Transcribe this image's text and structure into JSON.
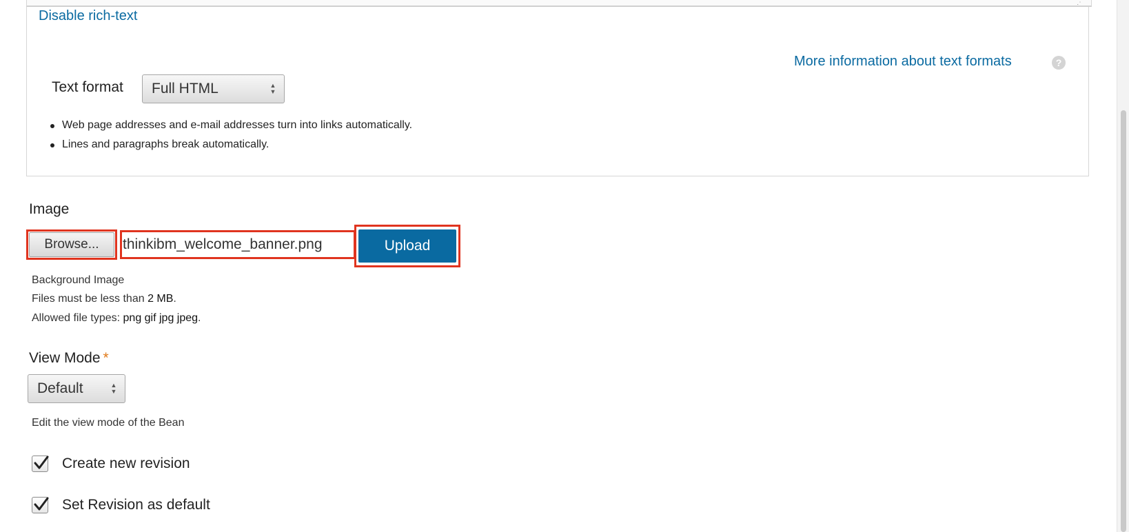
{
  "editor": {
    "disable_rich_text_link": "Disable rich-text",
    "more_info_link": "More information about text formats",
    "help_icon_glyph": "?",
    "text_format_label": "Text format",
    "text_format_value": "Full HTML",
    "filter_tips": [
      "Web page addresses and e-mail addresses turn into links automatically.",
      "Lines and paragraphs break automatically."
    ]
  },
  "image_field": {
    "label": "Image",
    "browse_label": "Browse...",
    "file_name": "thinkibm_welcome_banner.png",
    "upload_label": "Upload",
    "description": "Background Image",
    "size_prefix": "Files must be less than ",
    "size_value": "2 MB",
    "size_suffix": ".",
    "types_prefix": "Allowed file types: ",
    "types_value": "png gif jpg jpeg",
    "types_suffix": "."
  },
  "view_mode": {
    "label": "View Mode",
    "required_marker": "*",
    "value": "Default",
    "description": "Edit the view mode of the Bean"
  },
  "options": {
    "create_revision_label": "Create new revision",
    "create_revision_checked": true,
    "set_default_label": "Set Revision as default",
    "set_default_checked": true
  },
  "colors": {
    "link": "#0a6aa1",
    "upload_button": "#0a6aa1",
    "highlight_border": "#e0341f",
    "required_marker": "#e07a1a"
  }
}
